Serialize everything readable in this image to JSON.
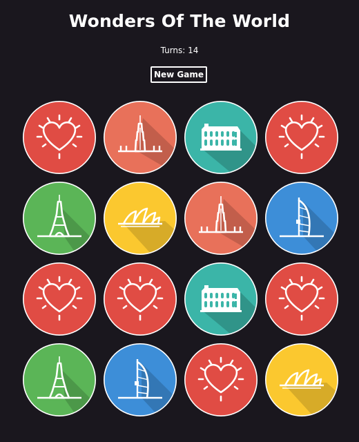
{
  "game": {
    "title": "Wonders Of The World",
    "turns_text": "Turns: 14",
    "new_game_label": "New Game"
  },
  "colors": {
    "background": "#1a171e",
    "heart": "#e04c44",
    "burj_khalifa": "#e8715a",
    "colosseum": "#3bb5a8",
    "eiffel_tower": "#5bb557",
    "sydney_opera_house": "#fbc82f",
    "burj_al_arab": "#3d8ed8"
  },
  "board": {
    "columns": 4,
    "tiles": [
      {
        "icon": "heart-icon",
        "color": "#e04c44"
      },
      {
        "icon": "burj-khalifa-icon",
        "color": "#e8715a"
      },
      {
        "icon": "colosseum-icon",
        "color": "#3bb5a8"
      },
      {
        "icon": "heart-icon",
        "color": "#e04c44"
      },
      {
        "icon": "eiffel-tower-icon",
        "color": "#5bb557"
      },
      {
        "icon": "sydney-opera-house-icon",
        "color": "#fbc82f"
      },
      {
        "icon": "burj-khalifa-icon",
        "color": "#e8715a"
      },
      {
        "icon": "burj-al-arab-icon",
        "color": "#3d8ed8"
      },
      {
        "icon": "heart-icon",
        "color": "#e04c44"
      },
      {
        "icon": "heart-icon",
        "color": "#e04c44"
      },
      {
        "icon": "colosseum-icon",
        "color": "#3bb5a8"
      },
      {
        "icon": "heart-icon",
        "color": "#e04c44"
      },
      {
        "icon": "eiffel-tower-icon",
        "color": "#5bb557"
      },
      {
        "icon": "burj-al-arab-icon",
        "color": "#3d8ed8"
      },
      {
        "icon": "heart-icon",
        "color": "#e04c44"
      },
      {
        "icon": "sydney-opera-house-icon",
        "color": "#fbc82f"
      }
    ]
  }
}
